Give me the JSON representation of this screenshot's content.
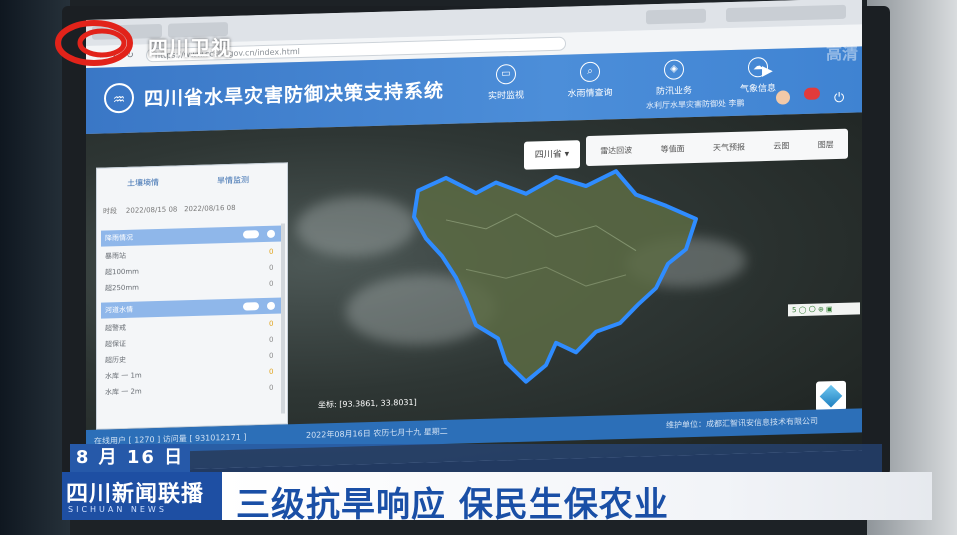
{
  "tv": {
    "station_name": "四川卫视",
    "hd_mark": "高清",
    "date": "8 月 16 日",
    "program_title": "四川新闻联播",
    "program_subtitle": "SICHUAN NEWS",
    "headline": "三级抗旱响应   保民生保农业"
  },
  "browser": {
    "address": "https://www.scslw.gov.cn/index.html"
  },
  "app": {
    "title": "四川省水旱灾害防御决策支持系统",
    "nav": [
      {
        "label": "实时监视",
        "icon": "monitor-icon"
      },
      {
        "label": "水雨情查询",
        "icon": "search-icon"
      },
      {
        "label": "防汛业务",
        "icon": "shield-icon"
      },
      {
        "label": "气象信息",
        "icon": "weather-icon"
      }
    ],
    "user": "水利厅水旱灾害防御处  李鹏"
  },
  "map": {
    "region": "四川省 ▾",
    "tools": [
      "雷达回波",
      "等值面",
      "天气预报",
      "云图",
      "图层"
    ],
    "coordinate": "坐标: [93.3861, 33.8031]",
    "scale": "5 ◯ 〇 ⊕ ▣"
  },
  "panel": {
    "tabs": [
      "土壤墒情",
      "旱情监测"
    ],
    "date_label": "时段",
    "date_from": "2022/08/15 08",
    "date_to": "2022/08/16 08",
    "rows": [
      {
        "label": "降雨情况",
        "value": "",
        "highlight": true
      },
      {
        "label": "暴雨站",
        "value": "0",
        "highlight": false
      },
      {
        "label": "超100mm",
        "value": "0",
        "highlight": false
      },
      {
        "label": "超250mm",
        "value": "0",
        "highlight": false
      },
      {
        "label": "河道水情",
        "value": "",
        "highlight": true
      },
      {
        "label": "超警戒",
        "value": "0",
        "highlight": false
      },
      {
        "label": "超保证",
        "value": "0",
        "highlight": false
      },
      {
        "label": "超历史",
        "value": "0",
        "highlight": false
      },
      {
        "label": "水库 一 1m",
        "value": "0",
        "highlight": false
      },
      {
        "label": "水库 一 2m",
        "value": "0",
        "highlight": false
      }
    ]
  },
  "status": {
    "left": "在线用户 [ 1270 ]   访问量 [ 931012171 ]",
    "date": "2022年08月16日 农历七月十九 星期二",
    "maintainer": "维护单位：成都汇智讯安信息技术有限公司"
  }
}
